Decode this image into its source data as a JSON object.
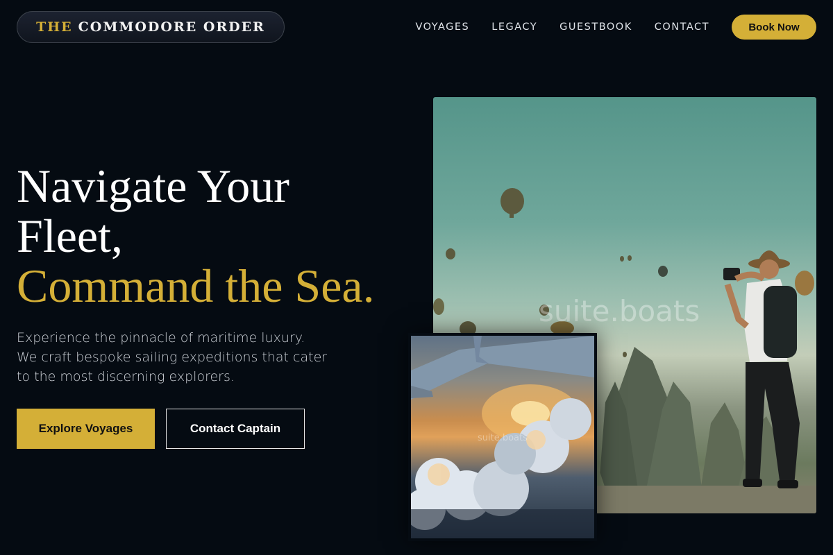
{
  "brand": {
    "prefix": "THE",
    "name": "COMMODORE ORDER"
  },
  "nav": {
    "items": [
      {
        "label": "VOYAGES"
      },
      {
        "label": "LEGACY"
      },
      {
        "label": "GUESTBOOK"
      },
      {
        "label": "CONTACT"
      }
    ],
    "cta": "Book Now"
  },
  "hero": {
    "title_line1": "Navigate Your",
    "title_line2": "Fleet,",
    "title_accent": "Command the Sea.",
    "subtitle": "Experience the pinnacle of maritime luxury. We craft bespoke sailing expeditions that cater to the most discerning explorers.",
    "primary_button": "Explore Voyages",
    "secondary_button": "Contact Captain"
  },
  "gallery": {
    "main_watermark": "suite.boats",
    "inset_watermark": "suite.boats"
  },
  "colors": {
    "background": "#050b12",
    "accent": "#d4af37",
    "text": "#ffffff"
  }
}
